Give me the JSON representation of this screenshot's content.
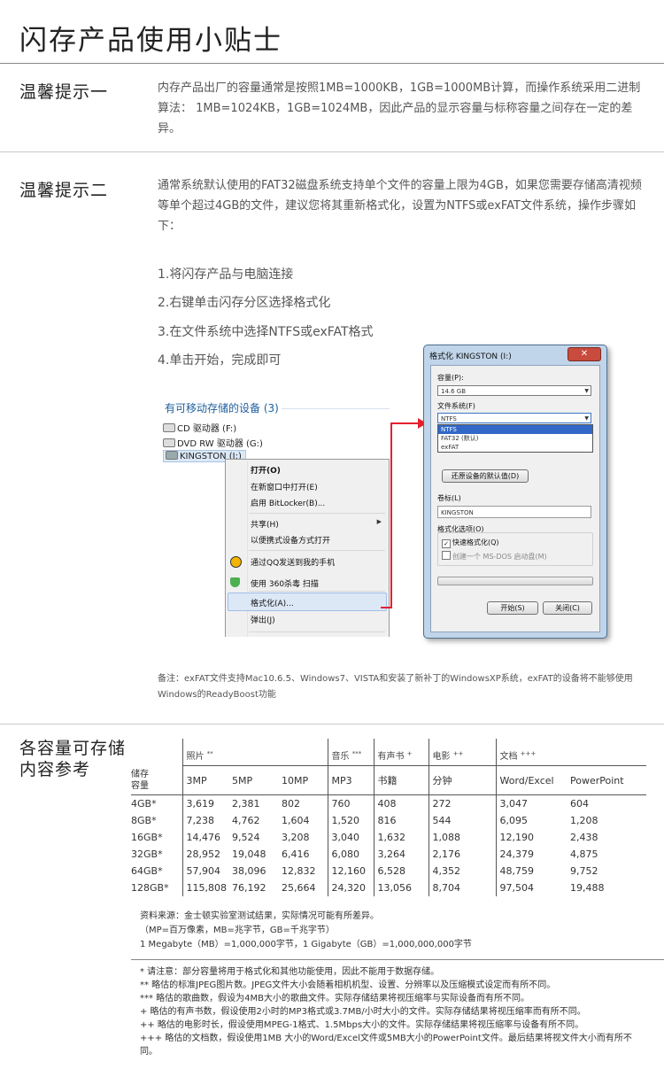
{
  "page": {
    "title": "闪存产品使用小贴士"
  },
  "tip1": {
    "title": "温馨提示一",
    "text": "内存产品出厂的容量通常是按照1MB=1000KB，1GB=1000MB计算，而操作系统采用二进制算法： 1MB=1024KB，1GB=1024MB，因此产品的显示容量与标称容量之间存在一定的差异。"
  },
  "tip2": {
    "title": "温馨提示二",
    "text": "通常系统默认使用的FAT32磁盘系统支持单个文件的容量上限为4GB，如果您需要存储高清视频等单个超过4GB的文件，建议您将其重新格式化，设置为NTFS或exFAT文件系统，操作步骤如下：",
    "steps": [
      "1.将闪存产品与电脑连接",
      "2.右键单击闪存分区选择格式化",
      "3.在文件系统中选择NTFS或exFAT格式",
      "4.单击开始，完成即可"
    ],
    "note": "备注：exFAT文件支持Mac10.6.5、Windows7、VISTA和安装了新补丁的WindowsXP系统，exFAT的设备将不能够使用Windows的ReadyBoost功能"
  },
  "explorer": {
    "group_title": "有可移动存储的设备 (3)",
    "drives": [
      "CD 驱动器 (F:)",
      "DVD RW 驱动器 (G:)",
      "KINGSTON (I:)"
    ],
    "menu": {
      "open": "打开(O)",
      "open_new": "在新窗口中打开(E)",
      "bitlocker": "启用 BitLocker(B)...",
      "share": "共享(H)",
      "portable": "以便携式设备方式打开",
      "qq": "通过QQ发送到我的手机",
      "scan360": "使用 360杀毒 扫描",
      "format": "格式化(A)...",
      "eject": "弹出(J)"
    }
  },
  "format_dialog": {
    "title": "格式化 KINGSTON (I:)",
    "close": "✕",
    "capacity_label": "容量(P):",
    "capacity_value": "14.6 GB",
    "fs_label": "文件系统(F)",
    "fs_value": "NTFS",
    "fs_options": [
      "NTFS",
      "FAT32 (默认)",
      "exFAT"
    ],
    "restore_button": "还原设备的默认值(D)",
    "volume_label": "卷标(L)",
    "volume_value": "KINGSTON",
    "options_label": "格式化选项(O)",
    "quick_format": "快速格式化(Q)",
    "msdos": "创建一个 MS-DOS 启动盘(M)",
    "start_button": "开始(S)",
    "close_button": "关闭(C)"
  },
  "capacity": {
    "title_line1": "各容量可存储",
    "title_line2": "内容参考",
    "row_header": [
      "储存",
      "容量"
    ],
    "groups": [
      {
        "label": "照片",
        "mark": "**"
      },
      {
        "label": "音乐",
        "mark": "***"
      },
      {
        "label": "有声书",
        "mark": "+"
      },
      {
        "label": "电影",
        "mark": "++"
      },
      {
        "label": "文档",
        "mark": "+++"
      }
    ],
    "columns": [
      "3MP",
      "5MP",
      "10MP",
      "MP3",
      "书籍",
      "分钟",
      "Word/Excel",
      "PowerPoint"
    ],
    "rows": [
      {
        "cap": "4GB*",
        "v": [
          "3,619",
          "2,381",
          "802",
          "760",
          "408",
          "272",
          "3,047",
          "604"
        ]
      },
      {
        "cap": "8GB*",
        "v": [
          "7,238",
          "4,762",
          "1,604",
          "1,520",
          "816",
          "544",
          "6,095",
          "1,208"
        ]
      },
      {
        "cap": "16GB*",
        "v": [
          "14,476",
          "9,524",
          "3,208",
          "3,040",
          "1,632",
          "1,088",
          "12,190",
          "2,438"
        ]
      },
      {
        "cap": "32GB*",
        "v": [
          "28,952",
          "19,048",
          "6,416",
          "6,080",
          "3,264",
          "2,176",
          "24,379",
          "4,875"
        ]
      },
      {
        "cap": "64GB*",
        "v": [
          "57,904",
          "38,096",
          "12,832",
          "12,160",
          "6,528",
          "4,352",
          "48,759",
          "9,752"
        ]
      },
      {
        "cap": "128GB*",
        "v": [
          "115,808",
          "76,192",
          "25,664",
          "24,320",
          "13,056",
          "8,704",
          "97,504",
          "19,488"
        ]
      }
    ],
    "source": [
      "资料来源：金士顿实验室测试结果，实际情况可能有所差异。",
      "（MP=百万像素，MB=兆字节，GB=千兆字节）",
      "1 Megabyte（MB）=1,000,000字节，1 Gigabyte（GB）=1,000,000,000字节"
    ],
    "footnotes": [
      "* 请注意：部分容量将用于格式化和其他功能使用，因此不能用于数据存储。",
      "** 略估的标准JPEG图片数。JPEG文件大小会随着相机机型、设置、分辨率以及压缩模式设定而有所不同。",
      "*** 略估的歌曲数，假设为4MB大小的歌曲文件。实际存储结果将视压缩率与实际设备而有所不同。",
      "+ 略估的有声书数，假设使用2小时的MP3格式或3.7MB/小时大小的文件。实际存储结果将视压缩率而有所不同。",
      "++ 略估的电影时长，假设使用MPEG-1格式、1.5Mbps大小的文件。实际存储结果将视压缩率与设备有所不同。",
      "+++ 略估的文档数，假设使用1MB 大小的Word/Excel文件或5MB大小的PowerPoint文件。最后结果将视文件大小而有所不同。"
    ]
  },
  "colors": {
    "accent_red": "#e3202f",
    "link_blue": "#1e5f9e",
    "select_blue": "#3168c7"
  }
}
